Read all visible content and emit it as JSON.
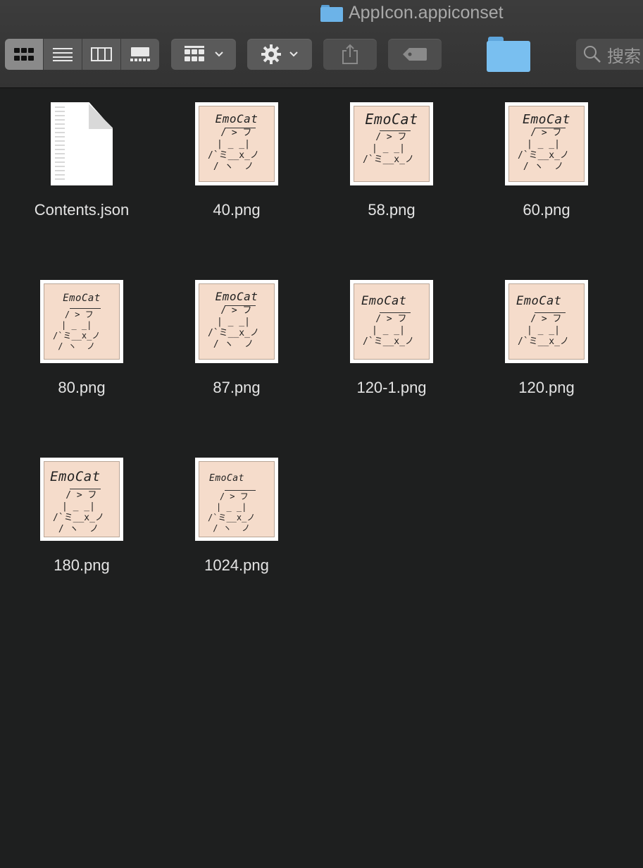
{
  "window": {
    "title": "AppIcon.appiconset"
  },
  "toolbar": {
    "view_modes": [
      "icon-view",
      "list-view",
      "column-view",
      "gallery-view"
    ],
    "active_view": "icon-view",
    "search_placeholder": "搜索"
  },
  "files": [
    {
      "name": "Contents.json",
      "kind": "json"
    },
    {
      "name": "40.png",
      "kind": "png"
    },
    {
      "name": "58.png",
      "kind": "png"
    },
    {
      "name": "60.png",
      "kind": "png"
    },
    {
      "name": "80.png",
      "kind": "png"
    },
    {
      "name": "87.png",
      "kind": "png"
    },
    {
      "name": "120-1.png",
      "kind": "png"
    },
    {
      "name": "120.png",
      "kind": "png"
    },
    {
      "name": "180.png",
      "kind": "png"
    },
    {
      "name": "1024.png",
      "kind": "png"
    }
  ],
  "thumbnail": {
    "brand": "EmoCat",
    "art_lines": [
      " / > フ",
      "| _ _|",
      "/`ミ__x_ノ",
      "/ ヽ  ノ"
    ]
  },
  "colors": {
    "background": "#1e1f1f",
    "toolbar": "#3a3a3a",
    "thumb_bg": "#f5dccb",
    "folder": "#79bff0"
  }
}
